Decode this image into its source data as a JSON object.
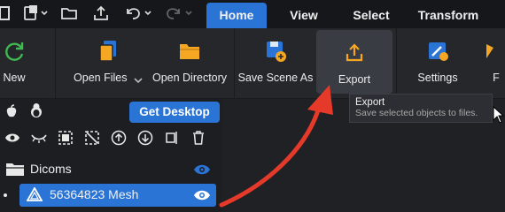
{
  "ribbon_tabs": [
    {
      "label": "Home",
      "active": true
    },
    {
      "label": "View",
      "active": false
    },
    {
      "label": "Select",
      "active": false
    },
    {
      "label": "Transform",
      "active": false
    }
  ],
  "ribbon": {
    "new_label": "New",
    "open_files_label": "Open Files",
    "open_directory_label": "Open Directory",
    "save_scene_label": "Save Scene As",
    "export_label": "Export",
    "settings_label": "Settings",
    "cut_off_label": "F"
  },
  "tooltip": {
    "title": "Export",
    "description": "Save selected objects to files."
  },
  "left_panel": {
    "get_desktop_label": "Get Desktop",
    "tree": [
      {
        "label": "Dicoms",
        "icon": "folder-icon",
        "selected": false
      },
      {
        "label": "56364823 Mesh",
        "icon": "mesh-triangle-icon",
        "selected": true
      }
    ]
  },
  "colors": {
    "accent": "#2a74d6",
    "background": "#1d1e22",
    "ribbon": "#25272b",
    "annotation_arrow": "#e53a2a",
    "icon_orange": "#f5a623",
    "icon_green": "#3fb950"
  }
}
